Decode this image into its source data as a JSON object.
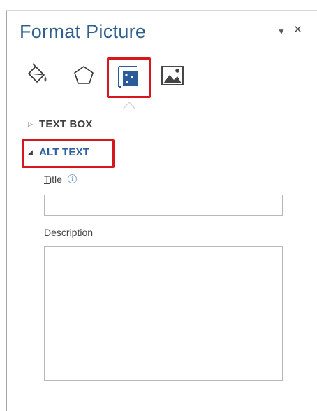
{
  "pane": {
    "title": "Format Picture",
    "options_glyph": "▼",
    "close_glyph": "×"
  },
  "tabs": [
    {
      "name": "Fill & Line",
      "icon": "paint-bucket-icon",
      "active": false
    },
    {
      "name": "Effects",
      "icon": "pentagon-icon",
      "active": false
    },
    {
      "name": "Size & Properties",
      "icon": "size-properties-icon",
      "active": true
    },
    {
      "name": "Picture",
      "icon": "picture-icon",
      "active": false
    }
  ],
  "sections": {
    "text_box": {
      "label": "TEXT BOX",
      "expanded": false,
      "caret": "▷"
    },
    "alt_text": {
      "label": "ALT TEXT",
      "expanded": true,
      "caret": "◢"
    }
  },
  "alt_text": {
    "title_label_first": "T",
    "title_label_rest": "itle",
    "title_info_glyph": "i",
    "title_value": "",
    "description_label_first": "D",
    "description_label_rest": "escription",
    "description_value": ""
  },
  "colors": {
    "title_blue": "#2f5f8f",
    "section_active_blue": "#2f5f9f",
    "highlight_red": "#d5171e",
    "icon_blue": "#2b5c9a"
  }
}
